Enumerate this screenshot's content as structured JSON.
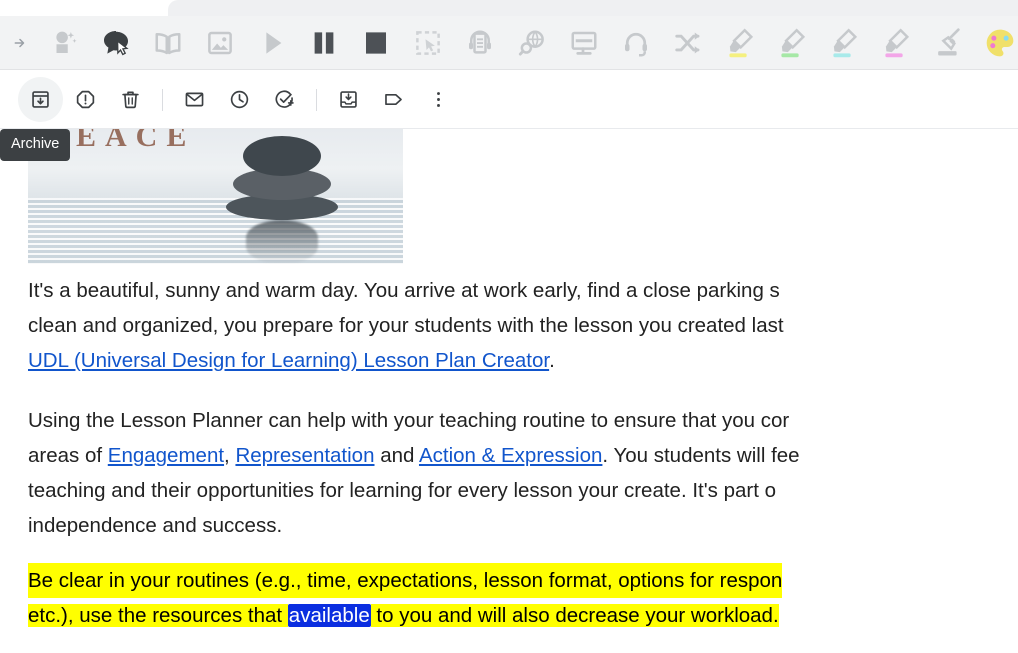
{
  "app": {
    "name": "Gmail message view with Read&Write extension toolbar"
  },
  "extension_toolbar": {
    "name": "read-write-toolbar",
    "background": "#f2f3f4",
    "tools": [
      {
        "id": "arrow",
        "icon": "arrow-right-icon",
        "label": "Expand toolbar",
        "state": "inactive",
        "accent": "#9aa0a6"
      },
      {
        "id": "predict",
        "icon": "magic-prediction-icon",
        "label": "Prediction",
        "state": "inactive",
        "accent": "#c2c5c8"
      },
      {
        "id": "speech",
        "icon": "speech-bubble-cursor-icon",
        "label": "Screenshot Reader",
        "state": "active",
        "accent": "#3c4043"
      },
      {
        "id": "dictionary",
        "icon": "open-book-icon",
        "label": "Dictionary",
        "state": "inactive",
        "accent": "#c2c5c8"
      },
      {
        "id": "picture-dictionary",
        "icon": "picture-dictionary-icon",
        "label": "Picture Dictionary",
        "state": "inactive",
        "accent": "#c2c5c8"
      },
      {
        "id": "play",
        "icon": "play-icon",
        "label": "Play",
        "state": "inactive",
        "accent": "#c2c5c8"
      },
      {
        "id": "pause",
        "icon": "pause-icon",
        "label": "Pause",
        "state": "active",
        "accent": "#4d5156"
      },
      {
        "id": "stop",
        "icon": "stop-icon",
        "label": "Stop",
        "state": "active",
        "accent": "#4d5156"
      },
      {
        "id": "screenshot",
        "icon": "screenshot-marquee-icon",
        "label": "Screenshot Reader",
        "state": "inactive",
        "accent": "#cdd0d3"
      },
      {
        "id": "audio-maker",
        "icon": "document-headphones-icon",
        "label": "Audio Maker",
        "state": "inactive",
        "accent": "#c2c5c8"
      },
      {
        "id": "research",
        "icon": "globe-magnifier-icon",
        "label": "Web Search",
        "state": "inactive",
        "accent": "#c2c5c8"
      },
      {
        "id": "screen-mask",
        "icon": "screen-mask-icon",
        "label": "Screen Mask",
        "state": "inactive",
        "accent": "#c2c5c8"
      },
      {
        "id": "voice-note",
        "icon": "headset-icon",
        "label": "Voice Note",
        "state": "inactive",
        "accent": "#c2c5c8"
      },
      {
        "id": "translate",
        "icon": "shuffle-arrows-icon",
        "label": "Translator",
        "state": "inactive",
        "accent": "#c2c5c8"
      },
      {
        "id": "highlight-yellow",
        "icon": "highlighter-pen-icon",
        "label": "Highlight yellow",
        "state": "inactive",
        "accent": "#c2c5c8",
        "color": "#f5f07f"
      },
      {
        "id": "highlight-green",
        "icon": "highlighter-pen-icon",
        "label": "Highlight green",
        "state": "inactive",
        "accent": "#c2c5c8",
        "color": "#a6e8a6"
      },
      {
        "id": "highlight-blue",
        "icon": "highlighter-pen-icon",
        "label": "Highlight blue",
        "state": "inactive",
        "accent": "#c2c5c8",
        "color": "#a8eaea"
      },
      {
        "id": "highlight-pink",
        "icon": "highlighter-pen-icon",
        "label": "Highlight pink",
        "state": "inactive",
        "accent": "#c2c5c8",
        "color": "#f3a6e8"
      },
      {
        "id": "clear-highlights",
        "icon": "eraser-brush-icon",
        "label": "Clear highlights",
        "state": "inactive",
        "accent": "#c2c5c8"
      },
      {
        "id": "collect-highlights",
        "icon": "color-palette-icon",
        "label": "Collect highlights",
        "state": "inactive",
        "accent": "#e8c0d8"
      }
    ]
  },
  "gmail_toolbar": {
    "name": "message-action-toolbar",
    "actions": [
      {
        "id": "archive",
        "icon": "archive-box-icon",
        "label": "Archive",
        "active": true
      },
      {
        "id": "report-spam",
        "icon": "report-spam-icon",
        "label": "Report spam",
        "active": false
      },
      {
        "id": "delete",
        "icon": "trash-icon",
        "label": "Delete",
        "active": false
      },
      {
        "id": "mark-unread",
        "icon": "envelope-icon",
        "label": "Mark as unread",
        "active": false
      },
      {
        "id": "snooze",
        "icon": "clock-icon",
        "label": "Snooze",
        "active": false
      },
      {
        "id": "add-to-tasks",
        "icon": "check-circle-plus-icon",
        "label": "Add to tasks",
        "active": false
      },
      {
        "id": "move-to",
        "icon": "move-to-inbox-icon",
        "label": "Move to",
        "active": false
      },
      {
        "id": "labels",
        "icon": "label-tag-icon",
        "label": "Labels",
        "active": false
      },
      {
        "id": "more",
        "icon": "more-vertical-icon",
        "label": "More",
        "active": false
      }
    ]
  },
  "tooltip": {
    "text": "Archive",
    "for": "archive"
  },
  "message": {
    "hero_image": {
      "name": "zen-stones-peace-banner",
      "overlay_text": "EACE",
      "full_word": "PEACE",
      "alt": "Stacked zen stones reflected in rippling water"
    },
    "paragraphs": [
      {
        "id": "p1",
        "highlight": false,
        "lines": [
          {
            "runs": [
              {
                "text": "It's a beautiful, sunny and warm day.  You arrive at work early, find a close parking s",
                "type": "text"
              }
            ]
          },
          {
            "runs": [
              {
                "text": "clean and organized, you prepare for your students with the lesson you created last",
                "type": "text"
              }
            ]
          },
          {
            "runs": [
              {
                "text": "UDL (Universal Design for Learning) Lesson Plan Creator",
                "type": "link"
              },
              {
                "text": ".",
                "type": "text"
              }
            ]
          }
        ]
      },
      {
        "id": "p2",
        "highlight": false,
        "lines": [
          {
            "runs": [
              {
                "text": "Using the Lesson Planner can help with your teaching routine to ensure that you cor",
                "type": "text"
              }
            ]
          },
          {
            "runs": [
              {
                "text": "areas of ",
                "type": "text"
              },
              {
                "text": "Engagement",
                "type": "link"
              },
              {
                "text": ", ",
                "type": "text"
              },
              {
                "text": "Representation",
                "type": "link"
              },
              {
                "text": " and ",
                "type": "text"
              },
              {
                "text": "Action & Expression",
                "type": "link"
              },
              {
                "text": ".  You students will fee",
                "type": "text"
              }
            ]
          },
          {
            "runs": [
              {
                "text": "teaching and their opportunities for learning for every lesson your create.  It's part o",
                "type": "text"
              }
            ]
          },
          {
            "runs": [
              {
                "text": "independence and success.",
                "type": "text"
              }
            ]
          }
        ]
      },
      {
        "id": "p3",
        "highlight": true,
        "highlight_color": "#ffff00",
        "lines": [
          {
            "runs": [
              {
                "text": "Be clear in your routines (e.g., time, expectations, lesson format, options for respon",
                "type": "highlight"
              }
            ]
          },
          {
            "runs": [
              {
                "text": "etc.), use the resources that ",
                "type": "highlight"
              },
              {
                "text": "available",
                "type": "selection"
              },
              {
                "text": " to you and will also decrease your workload.",
                "type": "highlight"
              }
            ]
          }
        ]
      }
    ]
  },
  "colors": {
    "link": "#1155cc",
    "highlight": "#ffff00",
    "selection_bg": "#0b2ee0",
    "selection_fg": "#ffffff",
    "tooltip_bg": "#3c4043",
    "toolbar_bg": "#f2f3f4",
    "body_text": "#222222"
  }
}
